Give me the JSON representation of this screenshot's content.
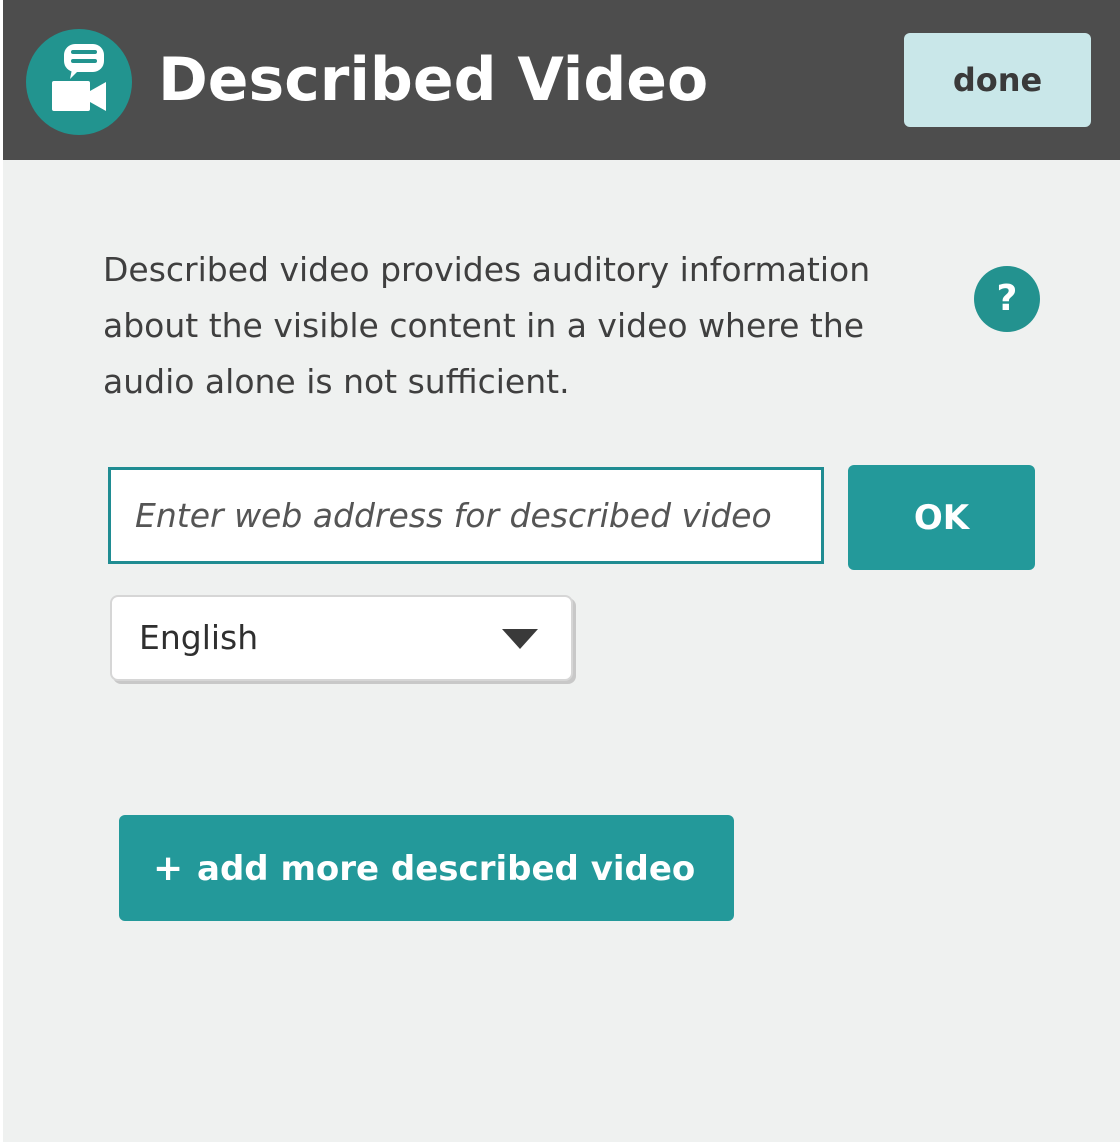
{
  "header": {
    "title": "Described Video",
    "done_label": "done",
    "logo_icon": "described-video-logo-icon"
  },
  "main": {
    "description": "Described video provides auditory information about the visible content in a video where the audio alone is not sufficient.",
    "help_label": "?",
    "url_input": {
      "placeholder": "Enter web address for described video",
      "value": ""
    },
    "ok_label": "OK",
    "language": {
      "selected": "English"
    },
    "add_more": {
      "icon": "+",
      "label": "add more described video"
    }
  },
  "colors": {
    "header_bg": "#4d4d4d",
    "accent": "#23999a",
    "done_bg": "#c9e7e9",
    "panel_bg": "#eff1f0"
  }
}
